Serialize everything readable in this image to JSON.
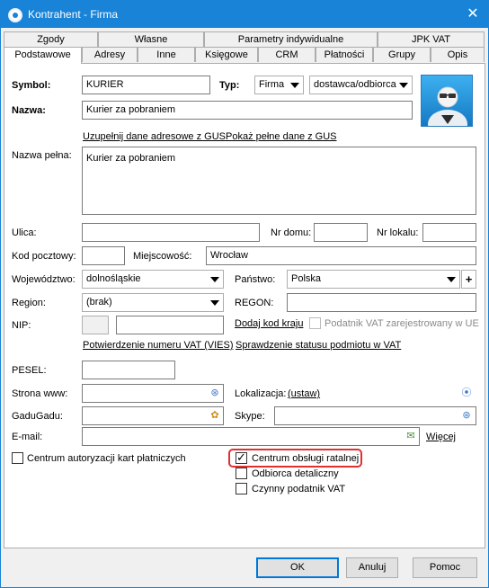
{
  "window": {
    "title": "Kontrahent - Firma"
  },
  "tabs_top": [
    "Zgody",
    "Własne",
    "Parametry indywidualne",
    "JPK VAT"
  ],
  "tabs_bottom": [
    "Podstawowe",
    "Adresy",
    "Inne",
    "Księgowe",
    "CRM",
    "Płatności",
    "Grupy",
    "Opis"
  ],
  "form": {
    "symbol_label": "Symbol:",
    "symbol_value": "KURIER",
    "typ_label": "Typ:",
    "typ_value": "Firma",
    "typ2_value": "dostawca/odbiorca",
    "nazwa_label": "Nazwa:",
    "nazwa_value": "Kurier za pobraniem",
    "gus_link": "Uzupełnij dane adresowe z GUS",
    "gus_full_link": "Pokaż pełne dane z GUS",
    "nazwa_pelna_label": "Nazwa pełna:",
    "nazwa_pelna_value": "Kurier za pobraniem",
    "ulica_label": "Ulica:",
    "ulica_value": "",
    "nr_domu_label": "Nr domu:",
    "nr_lokalu_label": "Nr lokalu:",
    "kod_label": "Kod pocztowy:",
    "miejscowosc_label": "Miejscowość:",
    "miejscowosc_value": "Wrocław",
    "woj_label": "Województwo:",
    "woj_value": "dolnośląskie",
    "panstwo_label": "Państwo:",
    "panstwo_value": "Polska",
    "region_label": "Region:",
    "region_value": "(brak)",
    "regon_label": "REGON:",
    "nip_label": "NIP:",
    "dodaj_kod_link": "Dodaj kod kraju",
    "vat_ue_label": "Podatnik VAT zarejestrowany w UE",
    "vies_link": "Potwierdzenie numeru VAT (VIES)",
    "status_link": "Sprawdzenie statusu podmiotu w VAT",
    "pesel_label": "PESEL:",
    "www_label": "Strona www:",
    "lokalizacja_label": "Lokalizacja:",
    "ustaw_link": "(ustaw)",
    "gadugadu_label": "GaduGadu:",
    "skype_label": "Skype:",
    "email_label": "E-mail:",
    "wiecej_link": "Więcej",
    "cakp_label": "Centrum autoryzacji kart płatniczych",
    "cor_label": "Centrum obsługi ratalnej",
    "odbiorca_label": "Odbiorca detaliczny",
    "czynny_label": "Czynny podatnik VAT"
  },
  "buttons": {
    "ok": "OK",
    "anuluj": "Anuluj",
    "pomoc": "Pomoc"
  }
}
